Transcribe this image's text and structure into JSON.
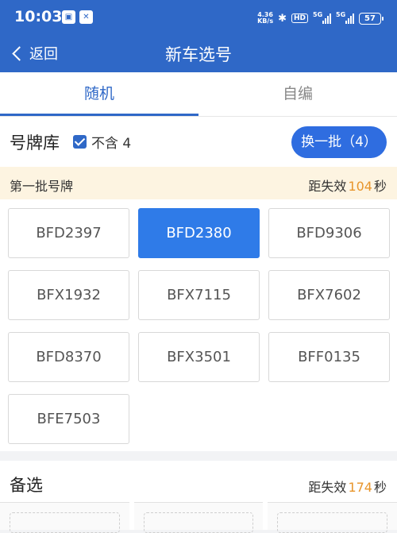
{
  "status_bar": {
    "time": "10:03",
    "app_badges": [
      "▣",
      "✕"
    ],
    "net_speed_value": "4.36",
    "net_speed_unit": "KB/s",
    "bluetooth_icon": "bluetooth-icon",
    "hd_label": "HD",
    "signal_1_label": "5G",
    "signal_2_label": "5G",
    "battery": "57"
  },
  "nav": {
    "back_label": "返回",
    "title": "新车选号"
  },
  "tabs": [
    {
      "label": "随机",
      "active": true
    },
    {
      "label": "自编",
      "active": false
    }
  ],
  "pool": {
    "title": "号牌库",
    "exclude_label": "不含 4",
    "exclude_checked": true,
    "refresh_label": "换一批（4）"
  },
  "batch": {
    "title": "第一批号牌",
    "countdown_prefix": "距失效",
    "countdown_value": "104",
    "countdown_suffix": "秒"
  },
  "plates": [
    {
      "number": "BFD2397",
      "selected": false
    },
    {
      "number": "BFD2380",
      "selected": true
    },
    {
      "number": "BFD9306",
      "selected": false
    },
    {
      "number": "BFX1932",
      "selected": false
    },
    {
      "number": "BFX7115",
      "selected": false
    },
    {
      "number": "BFX7602",
      "selected": false
    },
    {
      "number": "BFD8370",
      "selected": false
    },
    {
      "number": "BFX3501",
      "selected": false
    },
    {
      "number": "BFF0135",
      "selected": false
    },
    {
      "number": "BFE7503",
      "selected": false
    }
  ],
  "backup": {
    "title": "备选",
    "countdown_prefix": "距失效",
    "countdown_value": "174",
    "countdown_suffix": "秒"
  },
  "colors": {
    "primary": "#2f68c7",
    "selected_plate": "#2f7be8",
    "countdown_number": "#e8952b",
    "batch_bar_bg": "#fdf4e1"
  }
}
